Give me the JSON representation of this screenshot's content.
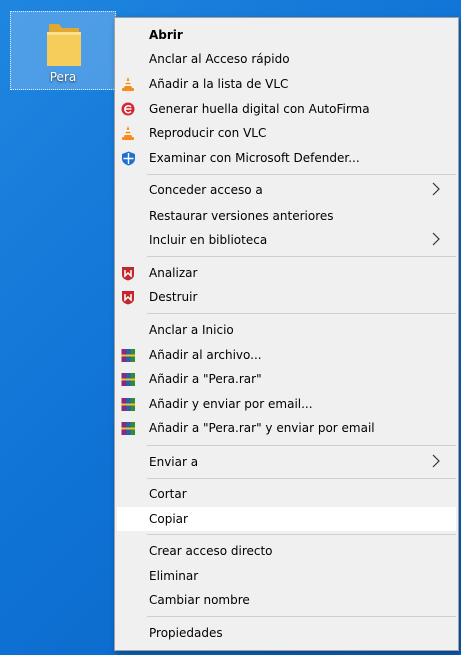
{
  "desktop": {
    "folder_label": "Pera"
  },
  "colors": {
    "menu_background": "#f0f0f0",
    "highlight": "#ffffff",
    "vlc_orange": "#f48b1a",
    "autofirma_red": "#d8242f",
    "defender_blue": "#1f6fd1",
    "mcafee_red": "#c2272d"
  },
  "menu": {
    "items": [
      {
        "label": "Abrir",
        "icon": null,
        "bold": true
      },
      {
        "label": "Anclar al Acceso rápido",
        "icon": null
      },
      {
        "label": "Añadir a la lista de VLC",
        "icon": "vlc-cone-icon"
      },
      {
        "label": "Generar huella digital con AutoFirma",
        "icon": "autofirma-icon"
      },
      {
        "label": "Reproducir con VLC",
        "icon": "vlc-cone-icon"
      },
      {
        "label": "Examinar con Microsoft Defender...",
        "icon": "defender-shield-icon"
      },
      {
        "label": "Conceder acceso a",
        "icon": null,
        "submenu": true
      },
      {
        "label": "Restaurar versiones anteriores",
        "icon": null
      },
      {
        "label": "Incluir en biblioteca",
        "icon": null,
        "submenu": true
      },
      {
        "label": "Analizar",
        "icon": "mcafee-shield-icon"
      },
      {
        "label": "Destruir",
        "icon": "mcafee-shield-icon"
      },
      {
        "label": "Anclar a Inicio",
        "icon": null
      },
      {
        "label": "Añadir al archivo...",
        "icon": "winrar-books-icon"
      },
      {
        "label": "Añadir a \"Pera.rar\"",
        "icon": "winrar-books-icon"
      },
      {
        "label": "Añadir y enviar por email...",
        "icon": "winrar-books-icon"
      },
      {
        "label": "Añadir a \"Pera.rar\" y enviar por email",
        "icon": "winrar-books-icon"
      },
      {
        "label": "Enviar a",
        "icon": null,
        "submenu": true
      },
      {
        "label": "Cortar",
        "icon": null
      },
      {
        "label": "Copiar",
        "icon": null,
        "highlighted": true
      },
      {
        "label": "Crear acceso directo",
        "icon": null
      },
      {
        "label": "Eliminar",
        "icon": null
      },
      {
        "label": "Cambiar nombre",
        "icon": null
      },
      {
        "label": "Propiedades",
        "icon": null
      }
    ]
  }
}
